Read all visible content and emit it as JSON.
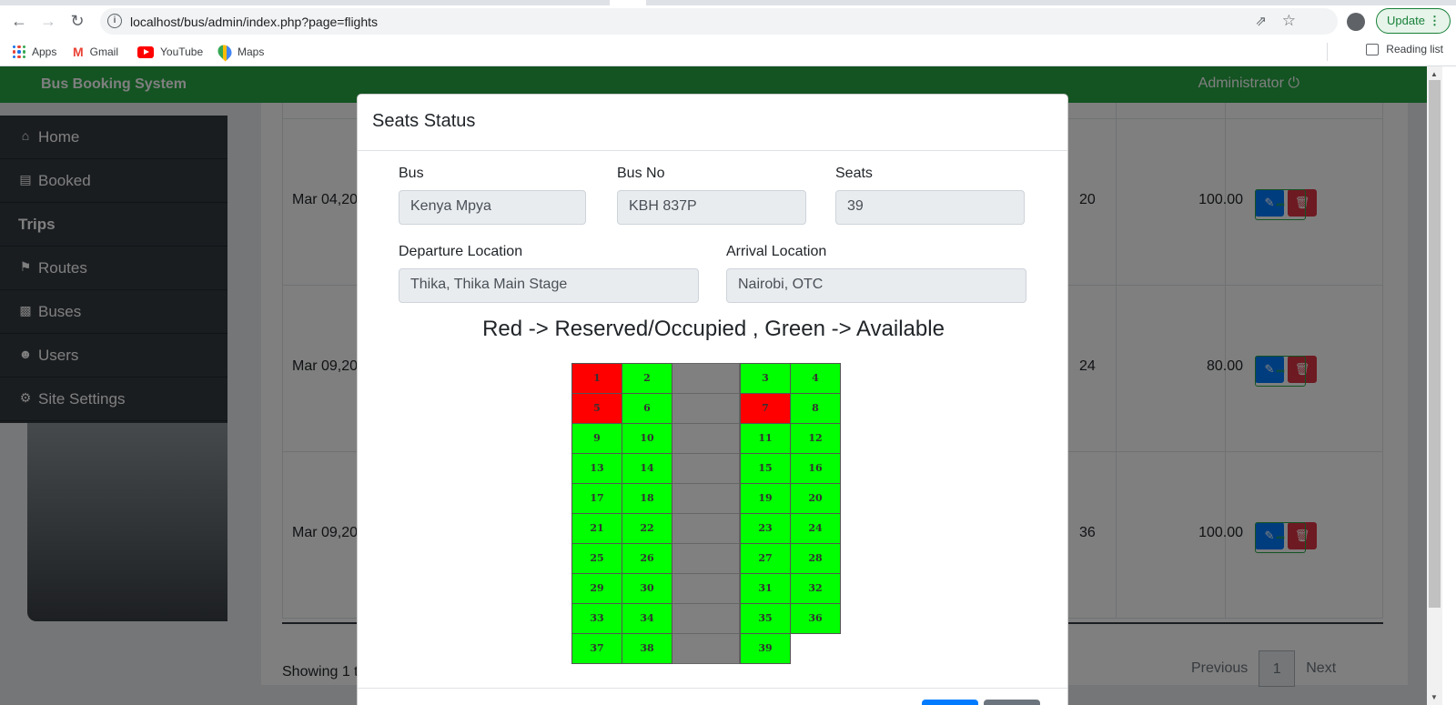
{
  "browser": {
    "url": "localhost/bus/admin/index.php?page=flights",
    "update_label": "Update",
    "bookmarks": {
      "apps": "Apps",
      "gmail": "Gmail",
      "youtube": "YouTube",
      "maps": "Maps",
      "reading_list": "Reading list"
    }
  },
  "navbar": {
    "brand": "Bus Booking System",
    "user": "Administrator"
  },
  "sidebar": {
    "items": [
      {
        "label": "Home",
        "icon": "home-icon"
      },
      {
        "label": "Booked",
        "icon": "book-icon"
      },
      {
        "label": "Trips",
        "icon": ""
      },
      {
        "label": "Routes",
        "icon": "route-icon"
      },
      {
        "label": "Buses",
        "icon": "building-icon"
      },
      {
        "label": "Users",
        "icon": "users-icon"
      },
      {
        "label": "Site Settings",
        "icon": "cog-icon"
      }
    ]
  },
  "table": {
    "rows": [
      {
        "date": "Mar 04,20",
        "available": "20",
        "price": "100.00"
      },
      {
        "date": "Mar 09,20",
        "available": "24",
        "price": "80.00"
      },
      {
        "date": "Mar 09,20",
        "available": "36",
        "price": "100.00"
      }
    ],
    "showing": "Showing 1 t",
    "pagination": {
      "previous": "Previous",
      "current": "1",
      "next": "Next"
    }
  },
  "modal": {
    "title": "Seats Status",
    "bus_label": "Bus",
    "bus_value": "Kenya Mpya",
    "bus_no_label": "Bus No",
    "bus_no_value": "KBH 837P",
    "seats_label": "Seats",
    "seats_value": "39",
    "departure_label": "Departure Location",
    "departure_value": "Thika, Thika Main Stage",
    "arrival_label": "Arrival Location",
    "arrival_value": "Nairobi, OTC",
    "legend": "Red -> Reserved/Occupied , Green -> Available",
    "seat_rows": [
      [
        {
          "n": "1",
          "s": "reserved"
        },
        {
          "n": "2",
          "s": "available"
        },
        {
          "n": "3",
          "s": "available"
        },
        {
          "n": "4",
          "s": "available"
        }
      ],
      [
        {
          "n": "5",
          "s": "reserved"
        },
        {
          "n": "6",
          "s": "available"
        },
        {
          "n": "7",
          "s": "reserved"
        },
        {
          "n": "8",
          "s": "available"
        }
      ],
      [
        {
          "n": "9",
          "s": "available"
        },
        {
          "n": "10",
          "s": "available"
        },
        {
          "n": "11",
          "s": "available"
        },
        {
          "n": "12",
          "s": "available"
        }
      ],
      [
        {
          "n": "13",
          "s": "available"
        },
        {
          "n": "14",
          "s": "available"
        },
        {
          "n": "15",
          "s": "available"
        },
        {
          "n": "16",
          "s": "available"
        }
      ],
      [
        {
          "n": "17",
          "s": "available"
        },
        {
          "n": "18",
          "s": "available"
        },
        {
          "n": "19",
          "s": "available"
        },
        {
          "n": "20",
          "s": "available"
        }
      ],
      [
        {
          "n": "21",
          "s": "available"
        },
        {
          "n": "22",
          "s": "available"
        },
        {
          "n": "23",
          "s": "available"
        },
        {
          "n": "24",
          "s": "available"
        }
      ],
      [
        {
          "n": "25",
          "s": "available"
        },
        {
          "n": "26",
          "s": "available"
        },
        {
          "n": "27",
          "s": "available"
        },
        {
          "n": "28",
          "s": "available"
        }
      ],
      [
        {
          "n": "29",
          "s": "available"
        },
        {
          "n": "30",
          "s": "available"
        },
        {
          "n": "31",
          "s": "available"
        },
        {
          "n": "32",
          "s": "available"
        }
      ],
      [
        {
          "n": "33",
          "s": "available"
        },
        {
          "n": "34",
          "s": "available"
        },
        {
          "n": "35",
          "s": "available"
        },
        {
          "n": "36",
          "s": "available"
        }
      ],
      [
        {
          "n": "37",
          "s": "available"
        },
        {
          "n": "38",
          "s": "available"
        },
        {
          "n": "39",
          "s": "available"
        }
      ]
    ]
  },
  "colors": {
    "navbar": "#28a745",
    "seat_available": "#00ff00",
    "seat_reserved": "#ff0000",
    "aisle": "#808080"
  }
}
